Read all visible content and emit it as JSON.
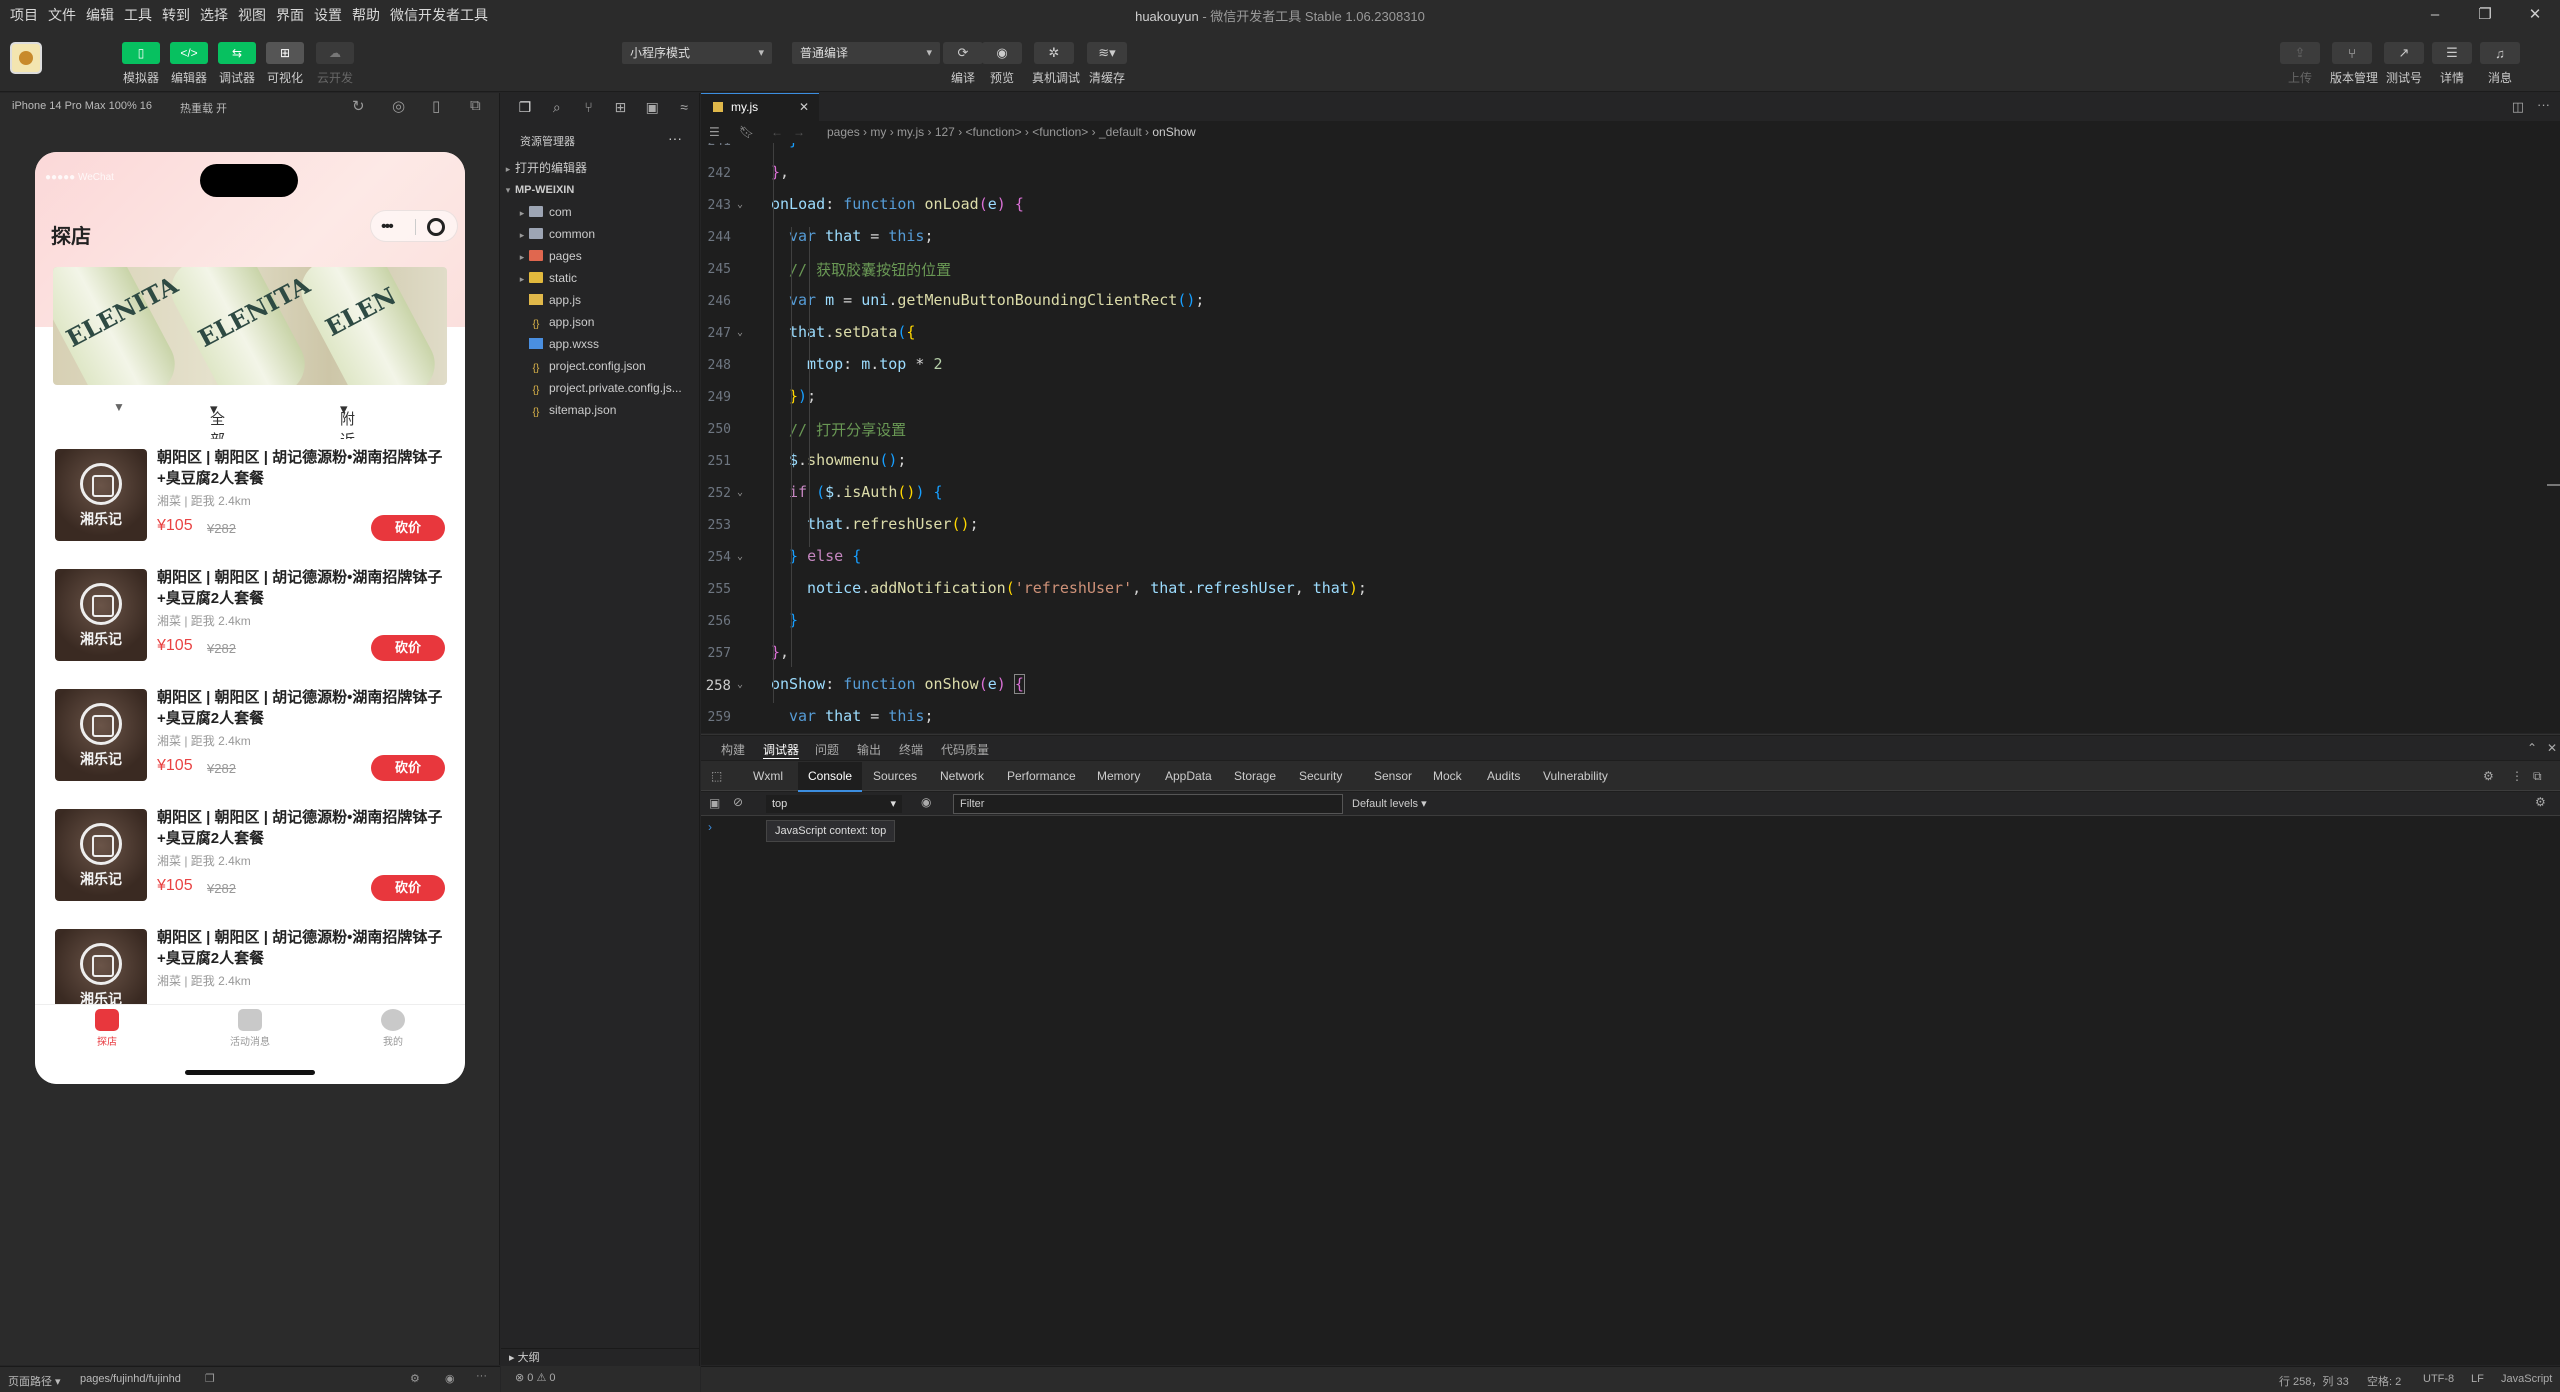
{
  "menu": [
    "项目",
    "文件",
    "编辑",
    "工具",
    "转到",
    "选择",
    "视图",
    "界面",
    "设置",
    "帮助",
    "微信开发者工具"
  ],
  "window_title": {
    "name": "huakouyun",
    "app": "微信开发者工具 Stable 1.06.2308310"
  },
  "toolbar": {
    "left_buttons": [
      {
        "label": "模拟器",
        "icon": "phone-icon"
      },
      {
        "label": "编辑器",
        "icon": "code-icon"
      },
      {
        "label": "调试器",
        "icon": "debug-icon"
      },
      {
        "label": "可视化",
        "icon": "layout-icon"
      },
      {
        "label": "云开发",
        "icon": "cloud-icon"
      }
    ],
    "mode_select": "小程序模式",
    "compile_select": "普通编译",
    "center_buttons": [
      {
        "label": "编译",
        "icon": "refresh-icon"
      },
      {
        "label": "预览",
        "icon": "eye-icon"
      },
      {
        "label": "真机调试",
        "icon": "bug-icon"
      },
      {
        "label": "清缓存",
        "icon": "layers-icon"
      }
    ],
    "right_buttons": [
      {
        "label": "上传",
        "icon": "upload-icon"
      },
      {
        "label": "版本管理",
        "icon": "branch-icon"
      },
      {
        "label": "测试号",
        "icon": "external-icon"
      },
      {
        "label": "详情",
        "icon": "menu-icon"
      },
      {
        "label": "消息",
        "icon": "bell-icon"
      }
    ]
  },
  "simulator": {
    "device": "iPhone 14 Pro Max 100% 16",
    "hotreload": "热重载 开",
    "status_left": "●●●●● WeChat",
    "page_title": "探店",
    "filters": [
      "全部活动",
      "附近全部"
    ],
    "cards": [
      {
        "name": "朝阳区 | 朝阳区 | 胡记德源粉•湖南招牌钵子+臭豆腐2人套餐",
        "meta": "湘菜 | 距我 2.4km",
        "price": "¥105",
        "old_price": "¥282",
        "button": "砍价",
        "logo_text": "湘乐记"
      },
      {
        "name": "朝阳区 | 朝阳区 | 胡记德源粉•湖南招牌钵子+臭豆腐2人套餐",
        "meta": "湘菜 | 距我 2.4km",
        "price": "¥105",
        "old_price": "¥282",
        "button": "砍价",
        "logo_text": "湘乐记"
      },
      {
        "name": "朝阳区 | 朝阳区 | 胡记德源粉•湖南招牌钵子+臭豆腐2人套餐",
        "meta": "湘菜 | 距我 2.4km",
        "price": "¥105",
        "old_price": "¥282",
        "button": "砍价",
        "logo_text": "湘乐记"
      },
      {
        "name": "朝阳区 | 朝阳区 | 胡记德源粉•湖南招牌钵子+臭豆腐2人套餐",
        "meta": "湘菜 | 距我 2.4km",
        "price": "¥105",
        "old_price": "¥282",
        "button": "砍价",
        "logo_text": "湘乐记"
      },
      {
        "name": "朝阳区 | 朝阳区 | 胡记德源粉•湖南招牌钵子+臭豆腐2人套餐",
        "meta": "湘菜 | 距我 2.4km",
        "price": "",
        "old_price": "",
        "button": "",
        "logo_text": "湘乐记"
      }
    ],
    "tabs": [
      {
        "label": "探店"
      },
      {
        "label": "活动消息"
      },
      {
        "label": "我的"
      }
    ],
    "footer_path_label": "页面路径",
    "footer_path": "pages/fujinhd/fujinhd"
  },
  "explorer": {
    "title": "资源管理器",
    "open_editors": "打开的编辑器",
    "root": "MP-WEIXIN",
    "items": [
      {
        "name": "com",
        "type": "folder"
      },
      {
        "name": "common",
        "type": "folder"
      },
      {
        "name": "pages",
        "type": "folder-red"
      },
      {
        "name": "static",
        "type": "folder-yellow"
      },
      {
        "name": "app.js",
        "type": "js"
      },
      {
        "name": "app.json",
        "type": "json"
      },
      {
        "name": "app.wxss",
        "type": "wxss"
      },
      {
        "name": "project.config.json",
        "type": "json"
      },
      {
        "name": "project.private.config.js...",
        "type": "json"
      },
      {
        "name": "sitemap.json",
        "type": "json"
      }
    ],
    "outline": "大纲",
    "problems": "⊗ 0 ⚠ 0"
  },
  "editor": {
    "tab": "my.js",
    "breadcrumb": [
      "pages",
      "my",
      "my.js",
      "127",
      "<function>",
      "<function>",
      "_default",
      "onShow"
    ],
    "status": {
      "position": "行 258，列 33",
      "spaces": "空格: 2",
      "encoding": "UTF-8",
      "eol": "LF",
      "language": "JavaScript"
    }
  },
  "devtools": {
    "panel_tabs": [
      "构建",
      "调试器",
      "问题",
      "输出",
      "终端",
      "代码质量"
    ],
    "tabs": [
      "Wxml",
      "Console",
      "Sources",
      "Network",
      "Performance",
      "Memory",
      "AppData",
      "Storage",
      "Security",
      "Sensor",
      "Mock",
      "Audits",
      "Vulnerability"
    ],
    "active_tab": "Console",
    "context": "top",
    "filter_placeholder": "Filter",
    "levels": "Default levels ▾",
    "tooltip": "JavaScript context: top"
  },
  "colors": {
    "accent": "#07c160",
    "price": "#e94343",
    "button": "#e8373d",
    "focus": "#3c8ee0"
  }
}
